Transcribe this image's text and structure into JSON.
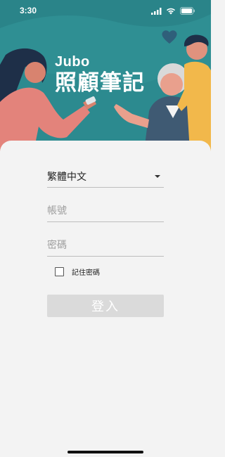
{
  "status": {
    "time": "3:30",
    "icons": [
      "cellular-signal-icon",
      "wifi-icon",
      "battery-icon"
    ]
  },
  "brand": {
    "logo": "Jubo",
    "title": "照顧筆記"
  },
  "form": {
    "language": "繁體中文",
    "account_placeholder": "帳號",
    "password_placeholder": "密碼",
    "remember_label": "記住密碼",
    "remember_checked": false,
    "login_label": "登入"
  },
  "colors": {
    "hero_teal": "#2f8f93",
    "card_bg": "#f3f3f3",
    "button_disabled": "#dadada"
  }
}
